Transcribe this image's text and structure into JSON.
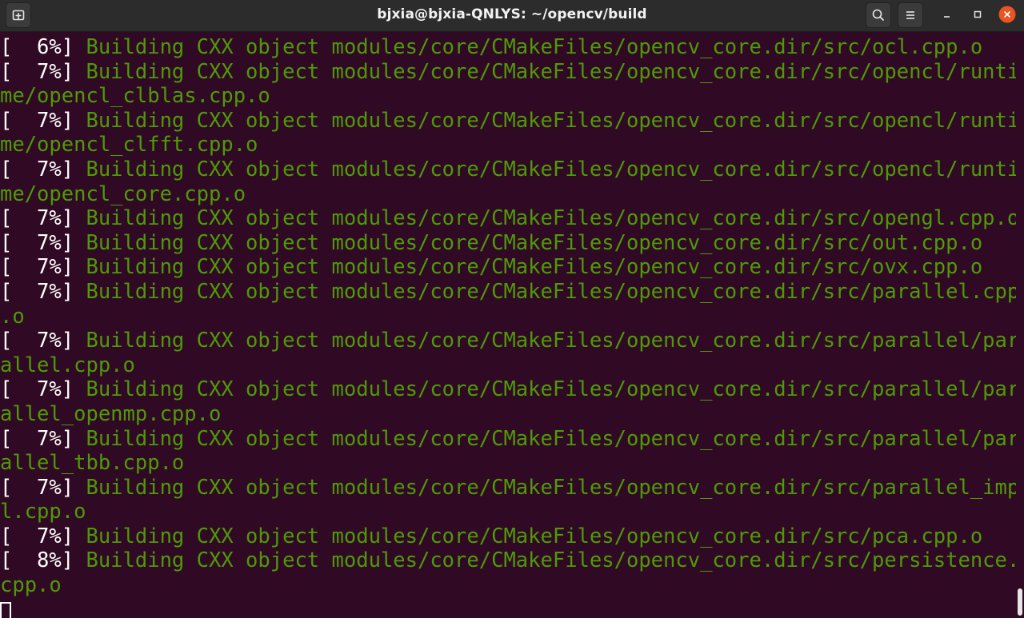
{
  "window": {
    "title": "bjxia@bjxia-QNLYS: ~/opencv/build"
  },
  "icons": {
    "new_tab": "new-tab-icon",
    "search": "search-icon",
    "menu": "hamburger-menu-icon",
    "minimize": "minimize-icon",
    "maximize": "maximize-icon",
    "close": "close-icon"
  },
  "colors": {
    "background": "#300a24",
    "progress_text": "#ffffff",
    "build_message": "#4e9a06",
    "close_button": "#e95420"
  },
  "terminal": {
    "rows": [
      {
        "p": "[  6%] ",
        "m": "Building CXX object modules/core/CMakeFiles/opencv_core.dir/src/ocl.cpp.o"
      },
      {
        "p": "[  7%] ",
        "m": "Building CXX object modules/core/CMakeFiles/opencv_core.dir/src/opencl/runti"
      },
      {
        "p": "",
        "m": "me/opencl_clblas.cpp.o"
      },
      {
        "p": "[  7%] ",
        "m": "Building CXX object modules/core/CMakeFiles/opencv_core.dir/src/opencl/runti"
      },
      {
        "p": "",
        "m": "me/opencl_clfft.cpp.o"
      },
      {
        "p": "[  7%] ",
        "m": "Building CXX object modules/core/CMakeFiles/opencv_core.dir/src/opencl/runti"
      },
      {
        "p": "",
        "m": "me/opencl_core.cpp.o"
      },
      {
        "p": "[  7%] ",
        "m": "Building CXX object modules/core/CMakeFiles/opencv_core.dir/src/opengl.cpp.o"
      },
      {
        "p": "[  7%] ",
        "m": "Building CXX object modules/core/CMakeFiles/opencv_core.dir/src/out.cpp.o"
      },
      {
        "p": "[  7%] ",
        "m": "Building CXX object modules/core/CMakeFiles/opencv_core.dir/src/ovx.cpp.o"
      },
      {
        "p": "[  7%] ",
        "m": "Building CXX object modules/core/CMakeFiles/opencv_core.dir/src/parallel.cpp"
      },
      {
        "p": "",
        "m": ".o"
      },
      {
        "p": "[  7%] ",
        "m": "Building CXX object modules/core/CMakeFiles/opencv_core.dir/src/parallel/par"
      },
      {
        "p": "",
        "m": "allel.cpp.o"
      },
      {
        "p": "[  7%] ",
        "m": "Building CXX object modules/core/CMakeFiles/opencv_core.dir/src/parallel/par"
      },
      {
        "p": "",
        "m": "allel_openmp.cpp.o"
      },
      {
        "p": "[  7%] ",
        "m": "Building CXX object modules/core/CMakeFiles/opencv_core.dir/src/parallel/par"
      },
      {
        "p": "",
        "m": "allel_tbb.cpp.o"
      },
      {
        "p": "[  7%] ",
        "m": "Building CXX object modules/core/CMakeFiles/opencv_core.dir/src/parallel_imp"
      },
      {
        "p": "",
        "m": "l.cpp.o"
      },
      {
        "p": "[  7%] ",
        "m": "Building CXX object modules/core/CMakeFiles/opencv_core.dir/src/pca.cpp.o"
      },
      {
        "p": "[  8%] ",
        "m": "Building CXX object modules/core/CMakeFiles/opencv_core.dir/src/persistence."
      },
      {
        "p": "",
        "m": "cpp.o"
      }
    ]
  }
}
